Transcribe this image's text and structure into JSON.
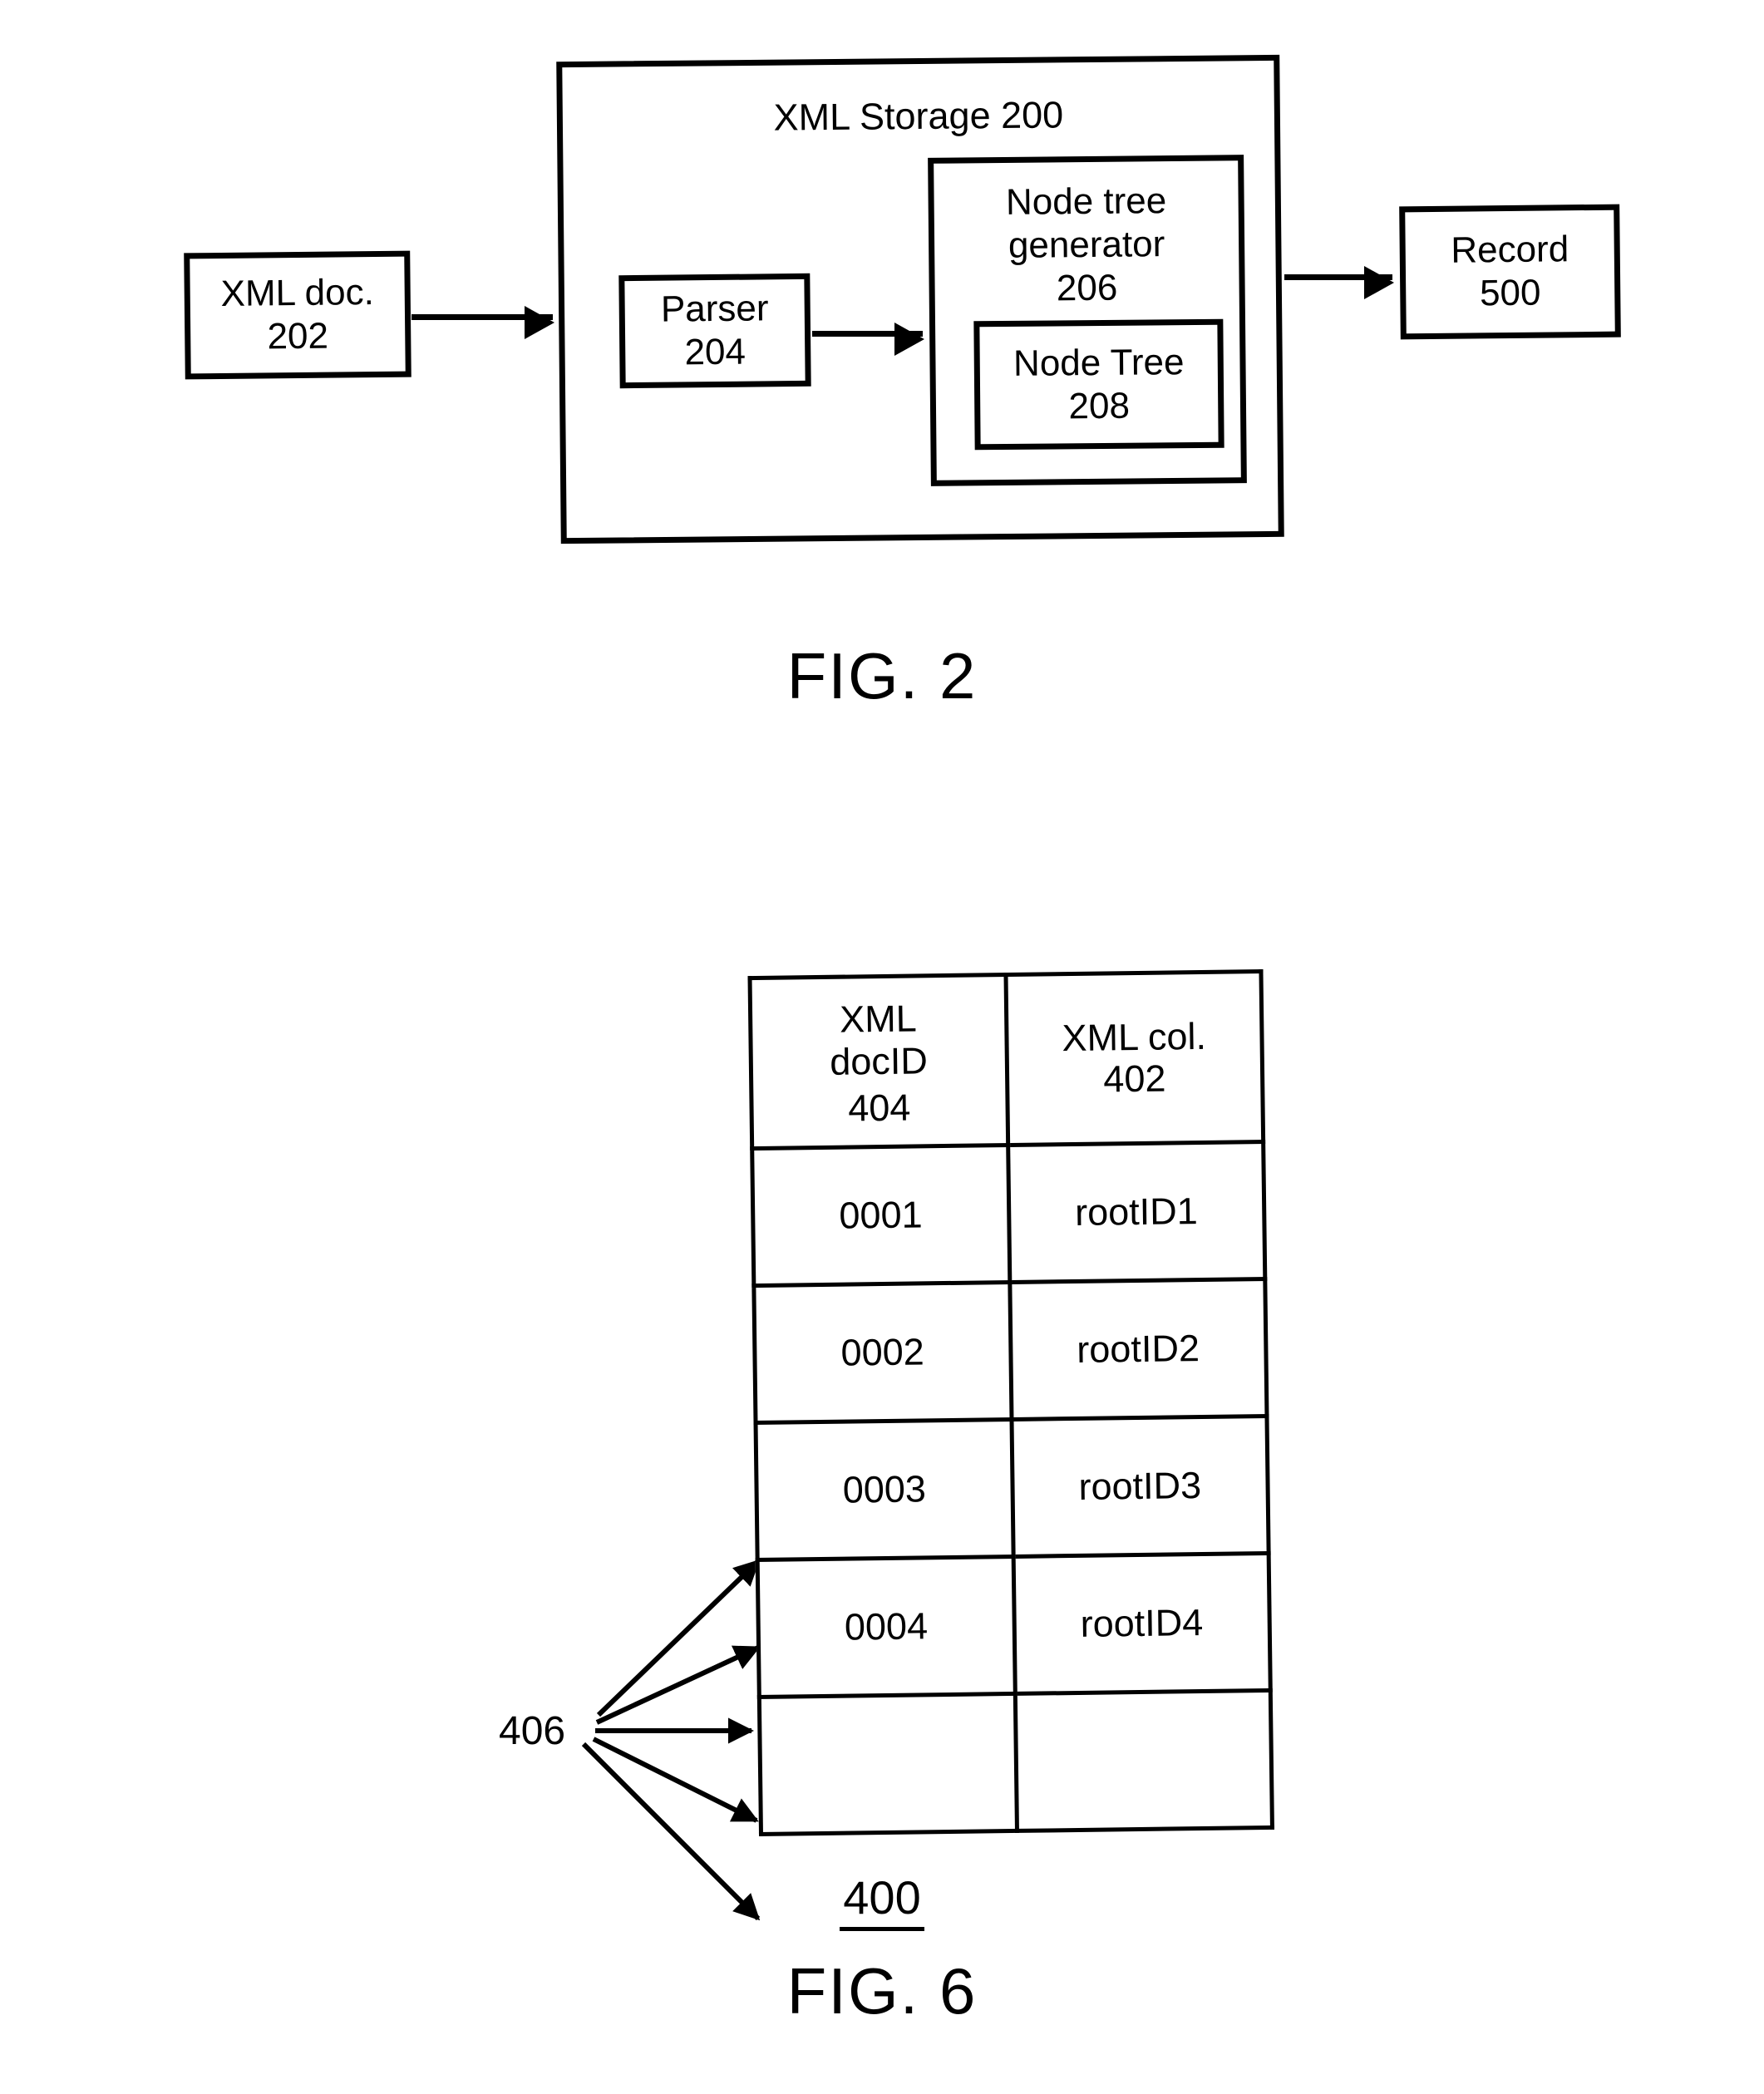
{
  "figure2": {
    "caption": "FIG. 2",
    "xml_doc_box": {
      "line1": "XML doc.",
      "line2": "202"
    },
    "xml_storage_box": {
      "title": "XML Storage 200"
    },
    "parser_box": {
      "line1": "Parser",
      "line2": "204"
    },
    "node_tree_generator_box": {
      "line1": "Node tree",
      "line2": "generator",
      "line3": "206"
    },
    "node_tree_box": {
      "line1": "Node Tree",
      "line2": "208"
    },
    "record_box": {
      "line1": "Record",
      "line2": "500"
    },
    "arrows": [
      {
        "name": "xml-doc-to-xml-storage"
      },
      {
        "name": "parser-to-node-tree-generator"
      },
      {
        "name": "node-tree-generator-to-record"
      }
    ]
  },
  "figure6": {
    "caption": "FIG. 6",
    "figure_number": "400",
    "callout_label": "406",
    "table": {
      "headers": {
        "col_a": {
          "line1": "XML",
          "line2": "docID",
          "line3": "404"
        },
        "col_b": {
          "line1": "XML col.",
          "line2": "402"
        }
      },
      "rows": [
        {
          "doc_id": "0001",
          "xml_col": "rootID1"
        },
        {
          "doc_id": "0002",
          "xml_col": "rootID2"
        },
        {
          "doc_id": "0003",
          "xml_col": "rootID3"
        },
        {
          "doc_id": "0004",
          "xml_col": "rootID4"
        },
        {
          "doc_id": "",
          "xml_col": ""
        }
      ]
    }
  },
  "colors": {
    "ink": "#000000",
    "paper": "#ffffff"
  }
}
